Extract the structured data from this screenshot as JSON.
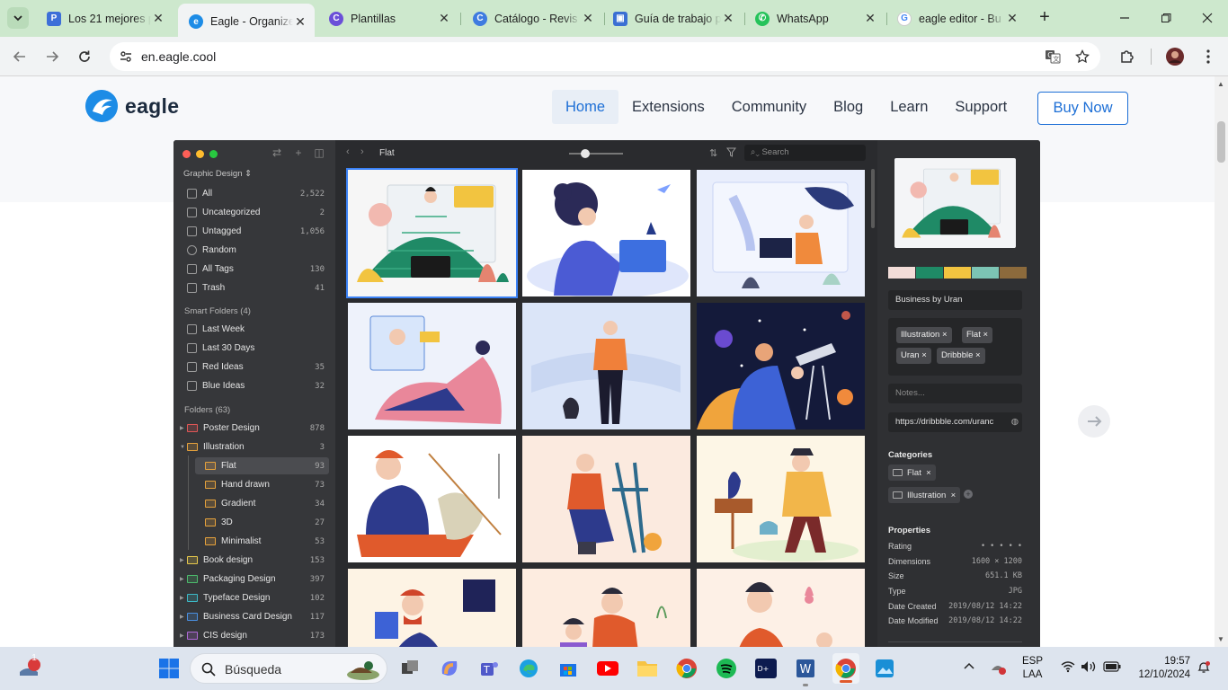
{
  "browser": {
    "tabs": [
      {
        "title": "Los 21 mejores p",
        "active": false
      },
      {
        "title": "Eagle - Organize",
        "active": true
      },
      {
        "title": "Plantillas",
        "active": false
      },
      {
        "title": "Catálogo - Revis",
        "active": false
      },
      {
        "title": "Guía de trabajo p",
        "active": false
      },
      {
        "title": "WhatsApp",
        "active": false
      },
      {
        "title": "eagle editor - Bu",
        "active": false
      }
    ],
    "url": "en.eagle.cool"
  },
  "site": {
    "logo_text": "eagle",
    "nav": [
      "Home",
      "Extensions",
      "Community",
      "Blog",
      "Learn",
      "Support"
    ],
    "nav_active": "Home",
    "buy_now": "Buy Now"
  },
  "app": {
    "library": "Graphic Design",
    "sidebar_main": [
      {
        "label": "All",
        "count": "2,522",
        "icon": "all-icon"
      },
      {
        "label": "Uncategorized",
        "count": "2",
        "icon": "uncategorized-icon"
      },
      {
        "label": "Untagged",
        "count": "1,056",
        "icon": "untagged-icon"
      },
      {
        "label": "Random",
        "count": "",
        "icon": "random-icon"
      },
      {
        "label": "All Tags",
        "count": "130",
        "icon": "tags-icon"
      },
      {
        "label": "Trash",
        "count": "41",
        "icon": "trash-icon"
      }
    ],
    "smart_folders_title": "Smart Folders (4)",
    "smart_folders": [
      {
        "label": "Last Week",
        "count": ""
      },
      {
        "label": "Last 30 Days",
        "count": ""
      },
      {
        "label": "Red Ideas",
        "count": "35"
      },
      {
        "label": "Blue Ideas",
        "count": "32"
      }
    ],
    "folders_title": "Folders (63)",
    "folders": [
      {
        "label": "Poster Design",
        "count": "878",
        "color": "#e05656",
        "level": 0,
        "arrow": "right"
      },
      {
        "label": "Illustration",
        "count": "3",
        "color": "#e6a23c",
        "level": 0,
        "arrow": "down"
      },
      {
        "label": "Flat",
        "count": "93",
        "color": "#e6a23c",
        "level": 1,
        "selected": true
      },
      {
        "label": "Hand drawn",
        "count": "73",
        "color": "#e6a23c",
        "level": 1
      },
      {
        "label": "Gradient",
        "count": "34",
        "color": "#e6a23c",
        "level": 1
      },
      {
        "label": "3D",
        "count": "27",
        "color": "#e6a23c",
        "level": 1
      },
      {
        "label": "Minimalist",
        "count": "53",
        "color": "#e6a23c",
        "level": 1
      },
      {
        "label": "Book design",
        "count": "153",
        "color": "#e6c84c",
        "level": 0,
        "arrow": "right"
      },
      {
        "label": "Packaging Design",
        "count": "397",
        "color": "#4cbb6c",
        "level": 0,
        "arrow": "right"
      },
      {
        "label": "Typeface Design",
        "count": "102",
        "color": "#3cb8c6",
        "level": 0,
        "arrow": "right"
      },
      {
        "label": "Business Card Design",
        "count": "117",
        "color": "#4a8fe0",
        "level": 0,
        "arrow": "right"
      },
      {
        "label": "CIS design",
        "count": "173",
        "color": "#b06ad8",
        "level": 0,
        "arrow": "right"
      }
    ],
    "grid": {
      "breadcrumb": "Flat",
      "search_placeholder": "Search"
    },
    "inspector": {
      "swatches": [
        "#f2dcd8",
        "#1f8a66",
        "#f2c440",
        "#7cc4b4",
        "#8c6a3c"
      ],
      "title": "Business by Uran",
      "tags": [
        "Illustration",
        "Flat",
        "Uran",
        "Dribbble"
      ],
      "notes_placeholder": "Notes...",
      "url": "https://dribbble.com/uranc",
      "categories_title": "Categories",
      "categories": [
        "Flat",
        "Illustration"
      ],
      "properties_title": "Properties",
      "properties": [
        {
          "label": "Rating",
          "value": "• • • • •"
        },
        {
          "label": "Dimensions",
          "value": "1600 × 1200"
        },
        {
          "label": "Size",
          "value": "651.1 KB"
        },
        {
          "label": "Type",
          "value": "JPG"
        },
        {
          "label": "Date Created",
          "value": "2019/08/12 14:22"
        },
        {
          "label": "Date Modified",
          "value": "2019/08/12 14:22"
        }
      ]
    }
  },
  "taskbar": {
    "search_label": "Búsqueda",
    "notification_badge": "1",
    "language": "ESP",
    "language_sub": "LAA",
    "time": "19:57",
    "date": "12/10/2024"
  }
}
